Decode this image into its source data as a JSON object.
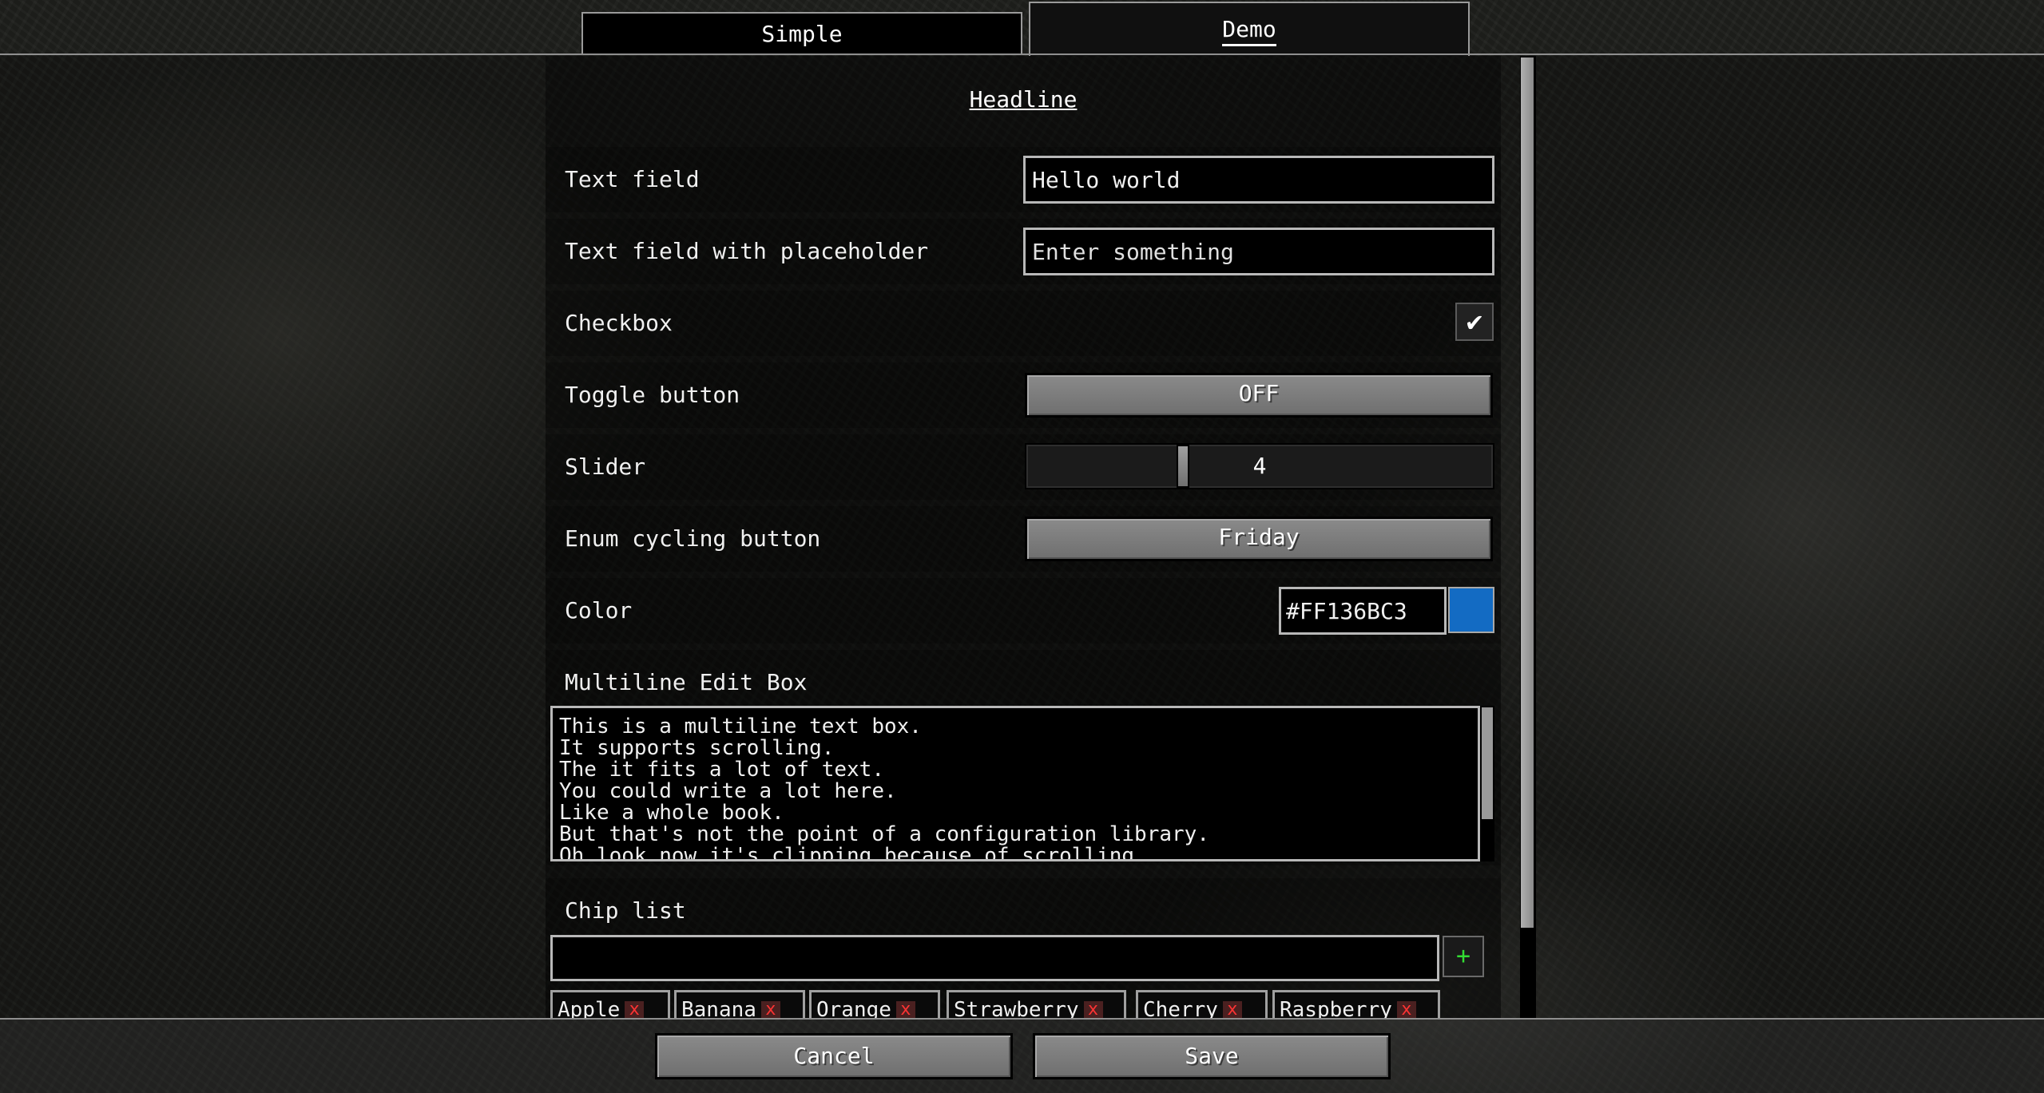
{
  "tabs": [
    {
      "label": "Simple",
      "selected": false
    },
    {
      "label": "Demo",
      "selected": true
    }
  ],
  "headline": "Headline",
  "rows": {
    "text_field": {
      "label": "Text field",
      "value": "Hello world"
    },
    "text_field_placeholder": {
      "label": "Text field with placeholder",
      "placeholder": "Enter something"
    },
    "checkbox": {
      "label": "Checkbox",
      "checked": true,
      "mark": "✔"
    },
    "toggle": {
      "label": "Toggle button",
      "value": "OFF"
    },
    "slider": {
      "label": "Slider",
      "value": "4"
    },
    "enum": {
      "label": "Enum cycling button",
      "value": "Friday"
    },
    "color": {
      "label": "Color",
      "value": "#FF136BC3",
      "swatch": "#136BC3"
    }
  },
  "multiline": {
    "label": "Multiline Edit Box",
    "lines": [
      "This is a multiline text box.",
      "It supports scrolling.",
      "The it fits a lot of text.",
      "You could write a lot here.",
      "Like a whole book.",
      "But that's not the point of a configuration library.",
      "Oh look now it's clipping because of scrolling"
    ]
  },
  "chip_list": {
    "label": "Chip list",
    "add_label": "+",
    "remove_glyph": "x",
    "chips": [
      "Apple",
      "Banana",
      "Orange",
      "Strawberry",
      "Cherry",
      "Raspberry"
    ]
  },
  "footer": {
    "cancel_label": "Cancel",
    "save_label": "Save"
  },
  "colors": {
    "swatch": "#136BC3",
    "add_icon": "#33DD33",
    "remove_icon": "#FF3333"
  }
}
